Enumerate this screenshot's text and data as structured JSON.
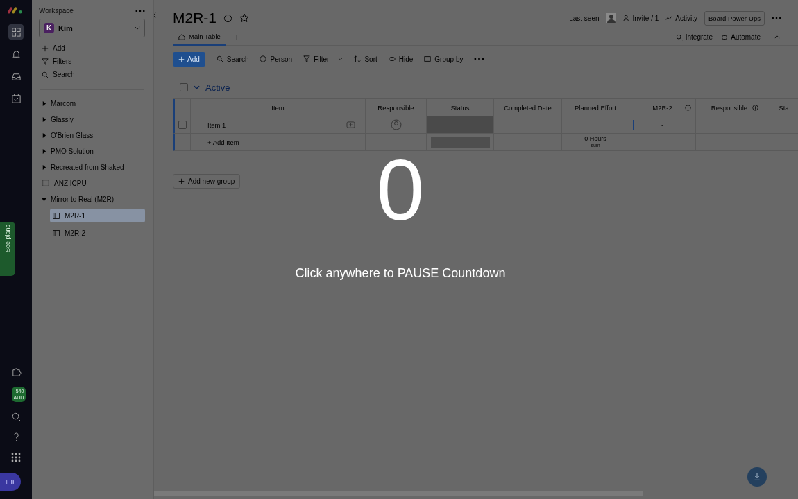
{
  "rail": {
    "items": [
      {
        "kind": "grid",
        "selected": true
      },
      {
        "kind": "bell",
        "selected": false
      },
      {
        "kind": "inbox",
        "selected": false
      },
      {
        "kind": "calendar",
        "selected": false
      }
    ],
    "see_plans": "See plans",
    "credits": [
      "540",
      "AUD"
    ]
  },
  "sidebar": {
    "heading": "Workspace",
    "workspace": {
      "avatar": "K",
      "name": "Kim"
    },
    "actions": [
      {
        "kind": "add",
        "label": "Add"
      },
      {
        "kind": "filter",
        "label": "Filters"
      },
      {
        "kind": "search",
        "label": "Search"
      }
    ],
    "tree": [
      {
        "kind": "folder",
        "label": "Marcom",
        "expanded": false
      },
      {
        "kind": "folder",
        "label": "Glassly",
        "expanded": false
      },
      {
        "kind": "folder",
        "label": "O'Brien Glass",
        "expanded": false
      },
      {
        "kind": "folder",
        "label": "PMO Solution",
        "expanded": false
      },
      {
        "kind": "folder",
        "label": "Recreated from Shaked",
        "expanded": false
      },
      {
        "kind": "dashboard",
        "label": "ANZ ICPU"
      },
      {
        "kind": "folder",
        "label": "Mirror to Real (M2R)",
        "expanded": true,
        "children": [
          {
            "kind": "board",
            "label": "M2R-1",
            "selected": true
          },
          {
            "kind": "board",
            "label": "M2R-2",
            "selected": false
          }
        ]
      }
    ]
  },
  "header": {
    "title": "M2R-1",
    "last_seen": "Last seen",
    "invite": "Invite / 1",
    "activity": "Activity",
    "power_ups": "Board Power-Ups",
    "tabs": [
      {
        "label": "Main Table",
        "selected": true
      }
    ],
    "add_tab": "+",
    "integrate": "Integrate",
    "automate": "Automate"
  },
  "toolbar": {
    "add": "Add",
    "items": [
      {
        "kind": "search",
        "label": "Search"
      },
      {
        "kind": "person",
        "label": "Person"
      },
      {
        "kind": "filter",
        "label": "Filter"
      },
      {
        "kind": "sort",
        "label": "Sort"
      },
      {
        "kind": "hide",
        "label": "Hide"
      },
      {
        "kind": "group",
        "label": "Group by"
      }
    ]
  },
  "group": {
    "name": "Active",
    "checked": false,
    "columns": [
      {
        "label": "Item",
        "info": false
      },
      {
        "label": "Responsible",
        "info": false
      },
      {
        "label": "Status",
        "info": false
      },
      {
        "label": "Completed Date",
        "info": false
      },
      {
        "label": "Planned Effort",
        "info": false
      },
      {
        "label": "M2R-2",
        "info": true
      },
      {
        "label": "Responsible",
        "info": true
      },
      {
        "label": "Sta",
        "info": false
      }
    ],
    "rows": [
      {
        "item": "Item 1",
        "checked": false,
        "mirror": "-"
      }
    ],
    "add_item": "+ Add Item",
    "effort_sum": "0 Hours",
    "sum_label": "sum"
  },
  "add_group": "Add new group",
  "countdown": {
    "number": "0",
    "message": "Click anywhere to PAUSE Countdown"
  }
}
